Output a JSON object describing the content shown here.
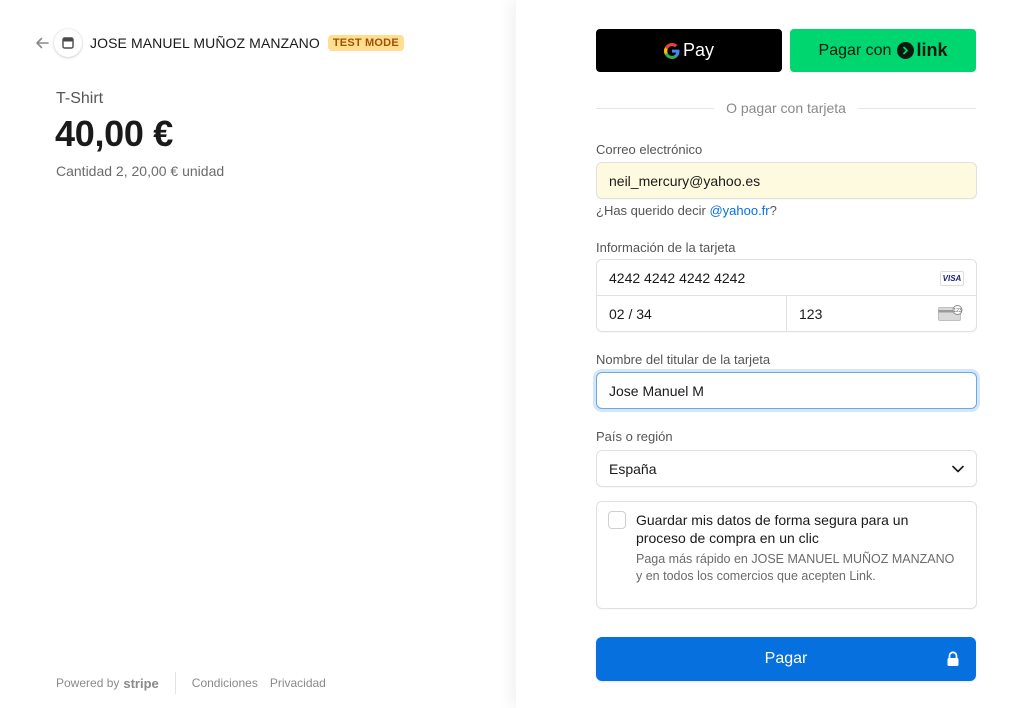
{
  "merchant": {
    "name": "JOSE MANUEL MUÑOZ MANZANO",
    "badge": "TEST MODE",
    "back_icon": "arrow-left-icon",
    "store_icon": "storefront-icon"
  },
  "product": {
    "name": "T-Shirt",
    "total": "40,00 €",
    "quantity_text": "Cantidad 2, 20,00 € unidad"
  },
  "footer": {
    "powered_by": "Powered by",
    "brand": "stripe",
    "terms": "Condiciones",
    "privacy": "Privacidad"
  },
  "wallets": {
    "gpay_label": "Pay",
    "link_prefix": "Pagar con",
    "link_brand": "link"
  },
  "separator": "O pagar con tarjeta",
  "email": {
    "label": "Correo electrónico",
    "value": "neil_mercury@yahoo.es",
    "suggestion_prefix": "¿Has querido decir",
    "suggestion_link": "@yahoo.fr",
    "suggestion_suffix": "?"
  },
  "card": {
    "label": "Información de la tarjeta",
    "number": "4242 4242 4242 4242",
    "brand": "VISA",
    "expiry": "02 / 34",
    "cvc": "123"
  },
  "cardholder": {
    "label": "Nombre del titular de la tarjeta",
    "value": "Jose Manuel M"
  },
  "country": {
    "label": "País o región",
    "value": "España"
  },
  "save": {
    "title": "Guardar mis datos de forma segura para un proceso de compra en un clic",
    "description": "Paga más rápido en JOSE MANUEL MUÑOZ MANZANO y en todos los comercios que acepten Link.",
    "checked": false
  },
  "pay_button": {
    "label": "Pagar",
    "icon": "lock-icon"
  },
  "colors": {
    "accent": "#0570de",
    "link_green": "#00d66f",
    "badge_bg": "#ffde92",
    "badge_text": "#a15200",
    "autofill_bg": "#fdfadf"
  }
}
